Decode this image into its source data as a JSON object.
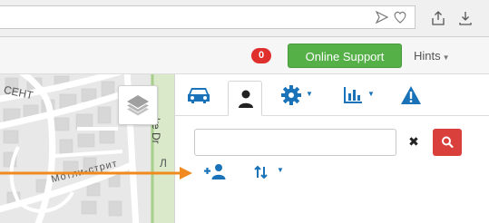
{
  "browser": {
    "url_value": "",
    "icons": [
      "send-icon",
      "heart-icon",
      "share-icon",
      "download-icon"
    ]
  },
  "header": {
    "notification_count": "0",
    "online_support_label": "Online Support",
    "hints_label": "Hints"
  },
  "map": {
    "street_labels": [
      "СЕНТ",
      "Мотли-стрит",
      "ke Dr",
      "Л"
    ]
  },
  "panel": {
    "tabs": [
      {
        "name": "vehicles",
        "icon": "car-icon"
      },
      {
        "name": "users",
        "icon": "user-icon",
        "active": true
      },
      {
        "name": "settings",
        "icon": "gear-icon"
      },
      {
        "name": "reports",
        "icon": "bar-chart-icon"
      },
      {
        "name": "alerts",
        "icon": "warning-icon"
      }
    ],
    "search": {
      "value": "",
      "placeholder": ""
    }
  },
  "colors": {
    "accent_blue": "#1a73b8",
    "badge_red": "#e0302e",
    "support_green": "#55b048",
    "search_red": "#d9403c",
    "arrow_orange": "#f08a1e"
  }
}
